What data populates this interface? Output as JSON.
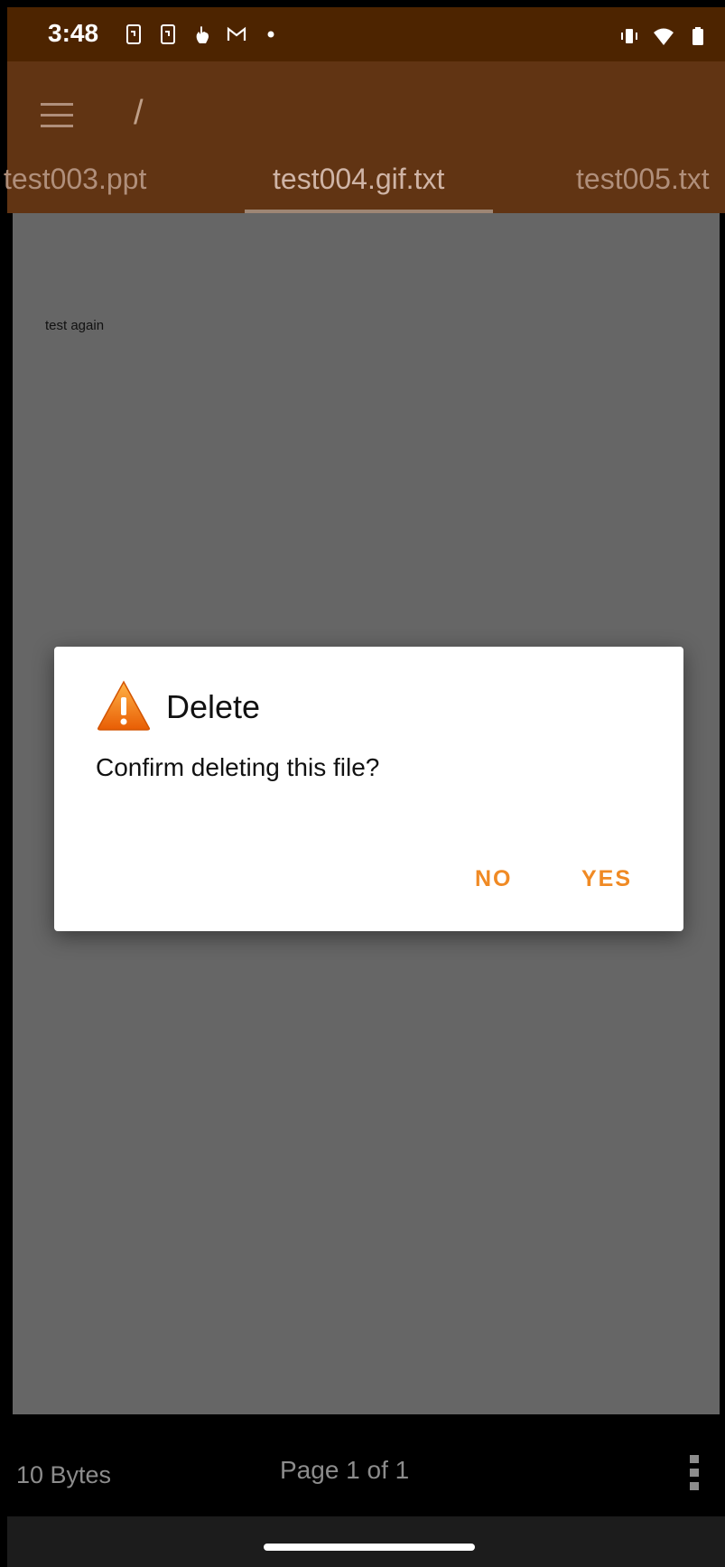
{
  "status_bar": {
    "time": "3:48",
    "left_icons": [
      "screenshot-icon",
      "screenshot-icon",
      "hand-touch-icon",
      "gmail-icon",
      "dot-icon"
    ],
    "right_icons": [
      "vibrate-icon",
      "wifi-icon",
      "battery-icon"
    ]
  },
  "app_bar": {
    "menu_icon": "hamburger-menu-icon",
    "path": "/",
    "tabs": [
      {
        "label": "test003.ppt"
      },
      {
        "label": "test004.gif.txt",
        "active": true
      },
      {
        "label": "test005.txt"
      }
    ]
  },
  "document": {
    "content": "test again"
  },
  "bottom_bar": {
    "size": "10 Bytes",
    "page": "Page 1 of 1",
    "more_icon": "more-vert-icon"
  },
  "dialog": {
    "icon": "warning-icon",
    "title": "Delete",
    "message": "Confirm deleting this file?",
    "no_label": "NO",
    "yes_label": "YES"
  },
  "colors": {
    "status_bar": "#4d2400",
    "app_bar": "#613413",
    "accent": "#f08a24",
    "scrim_content": "#666666"
  }
}
